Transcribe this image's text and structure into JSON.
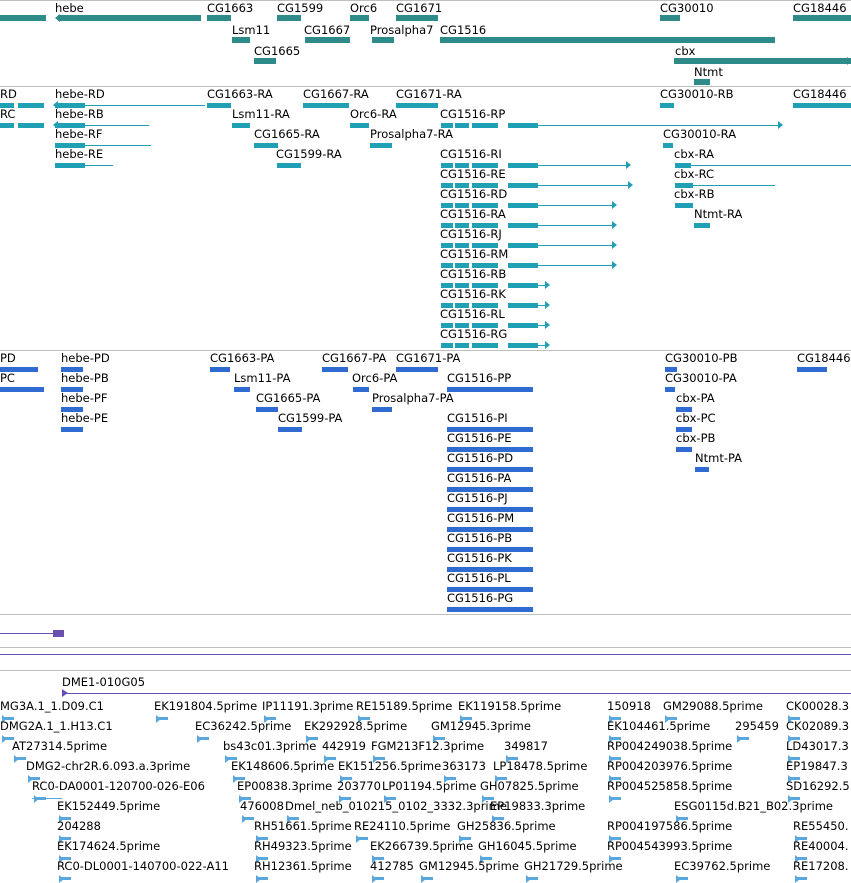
{
  "colors": {
    "gene": "#2f8a8a",
    "transcript": "#1fa0b4",
    "protein": "#2f6bd0",
    "purple": "#6b4fb0",
    "est": "#5aa7dd",
    "separator": "#bfbfbf"
  },
  "gene_track": {
    "labels": [
      "hebe",
      "CG1663",
      "CG1599",
      "Orc6",
      "CG1671",
      "CG30010",
      "CG18446",
      "Lsm11",
      "CG1667",
      "Prosalpha7",
      "CG1516",
      "CG1665",
      "cbx",
      "Ntmt"
    ]
  },
  "transcript_track": {
    "labels": [
      "RD",
      "hebe-RD",
      "CG1663-RA",
      "CG1667-RA",
      "CG1671-RA",
      "CG30010-RB",
      "CG18446",
      "RC",
      "hebe-RB",
      "Lsm11-RA",
      "Orc6-RA",
      "CG1516-RP",
      "hebe-RF",
      "CG1665-RA",
      "Prosalpha7-RA",
      "CG30010-RA",
      "hebe-RE",
      "CG1599-RA",
      "CG1516-RI",
      "cbx-RA",
      "CG1516-RE",
      "cbx-RC",
      "CG1516-RD",
      "cbx-RB",
      "CG1516-RA",
      "Ntmt-RA",
      "CG1516-RJ",
      "CG1516-RM",
      "CG1516-RB",
      "CG1516-RK",
      "CG1516-RL",
      "CG1516-RG"
    ]
  },
  "protein_track": {
    "labels": [
      "PD",
      "hebe-PD",
      "CG1663-PA",
      "CG1667-PA",
      "CG1671-PA",
      "CG30010-PB",
      "CG18446",
      "PC",
      "hebe-PB",
      "Lsm11-PA",
      "Orc6-PA",
      "CG1516-PP",
      "CG30010-PA",
      "hebe-PF",
      "CG1665-PA",
      "Prosalpha7-PA",
      "cbx-PA",
      "hebe-PE",
      "CG1599-PA",
      "CG1516-PI",
      "cbx-PC",
      "CG1516-PE",
      "cbx-PB",
      "CG1516-PD",
      "Ntmt-PA",
      "CG1516-PA",
      "CG1516-PJ",
      "CG1516-PM",
      "CG1516-PB",
      "CG1516-PK",
      "CG1516-PL",
      "CG1516-PG"
    ]
  },
  "clone_track": {
    "label": "DME1-010G05"
  },
  "est_track": {
    "labels": [
      "MG3A.1_1.D09.C1",
      "EK191804.5prime",
      "IP11191.3prime",
      "RE15189.5prime",
      "EK119158.5prime",
      "150918",
      "GM29088.5prime",
      "CK00028.3",
      "DMG2A.1_1.H13.C1",
      "EC36242.5prime",
      "EK292928.5prime",
      "GM12945.3prime",
      "EK104461.5prime",
      "295459",
      "CK02089.3",
      "AT27314.5prime",
      "bs43c01.3prime",
      "442919",
      "FGM213F12.3prime",
      "349817",
      "RP004249038.5prime",
      "LD43017.3",
      "DMG2-chr2R.6.093.a.3prime",
      "EK148606.5prime",
      "EK151256.5prime",
      "363173",
      "LP18478.5prime",
      "RP004203976.5prime",
      "EP19847.3",
      "RC0-DA0001-120700-026-E06",
      "EP00838.3prime",
      "203770",
      "LP01194.5prime",
      "GH07825.5prime",
      "RP004525858.5prime",
      "SD16292.5",
      "EK152449.5prime",
      "476008",
      "Dmel_neb_010215_0102_3332.3prime",
      "EP19833.3prime",
      "ESG0115d.B21_B02.3prime",
      "204288",
      "RH51661.5prime",
      "RE24110.5prime",
      "GH25836.5prime",
      "RP004197586.5prime",
      "RE55450.",
      "EK174624.5prime",
      "RH49323.5prime",
      "EK266739.5prime",
      "GH16045.5prime",
      "RP004543993.5prime",
      "RE40004.",
      "RC0-DL0001-140700-022-A11",
      "RH12361.5prime",
      "412785",
      "GM12945.5prime",
      "GH21729.5prime",
      "EC39762.5prime",
      "RE17208."
    ]
  }
}
